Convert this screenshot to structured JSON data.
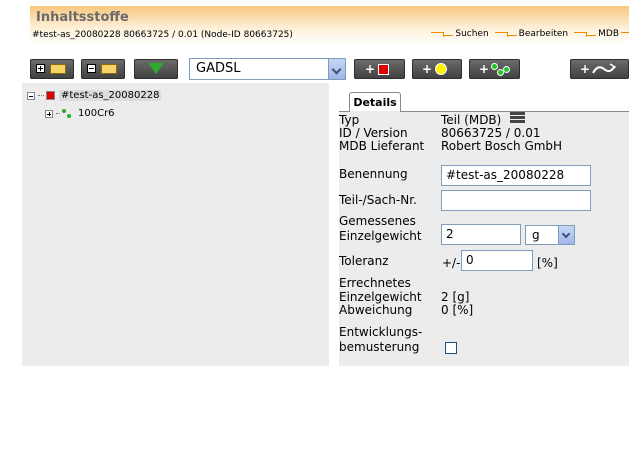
{
  "header": {
    "title": "Inhaltsstoffe",
    "subtitle": "#test-as_20080228 80663725 / 0.01 (Node-ID 80663725)",
    "nav": [
      {
        "label": "Suchen"
      },
      {
        "label": "Bearbeiten"
      },
      {
        "label": "MDB"
      }
    ]
  },
  "toolbar": {
    "list_select_value": "GADSL"
  },
  "tree": {
    "root_label": "#test-as_20080228",
    "child_label": "100Cr6"
  },
  "details": {
    "tab_label": "Details",
    "typ_label": "Typ",
    "typ_value": "Teil (MDB)",
    "id_label": "ID / Version",
    "id_value": "80663725 / 0.01",
    "lieferant_label": "MDB Lieferant",
    "lieferant_value": "Robert Bosch GmbH",
    "benennung_label": "Benennung",
    "benennung_value": "#test-as_20080228",
    "sachnr_label": "Teil-/Sach-Nr.",
    "sachnr_value": "",
    "gemessen_label_1": "Gemessenes",
    "gemessen_label_2": "Einzelgewicht",
    "gemessen_value": "2",
    "gemessen_unit": "g",
    "toleranz_label": "Toleranz",
    "toleranz_prefix": "+/-",
    "toleranz_value": "0",
    "toleranz_unit": "[%]",
    "errechnet_label_1": "Errechnetes",
    "errechnet_label_2": "Einzelgewicht",
    "errechnet_value": "2 [g]",
    "abweichung_label": "Abweichung",
    "abweichung_value": "0 [%]",
    "entwicklung_label_1": "Entwicklungs-",
    "entwicklung_label_2": "bemusterung",
    "entwicklung_checked": false
  }
}
